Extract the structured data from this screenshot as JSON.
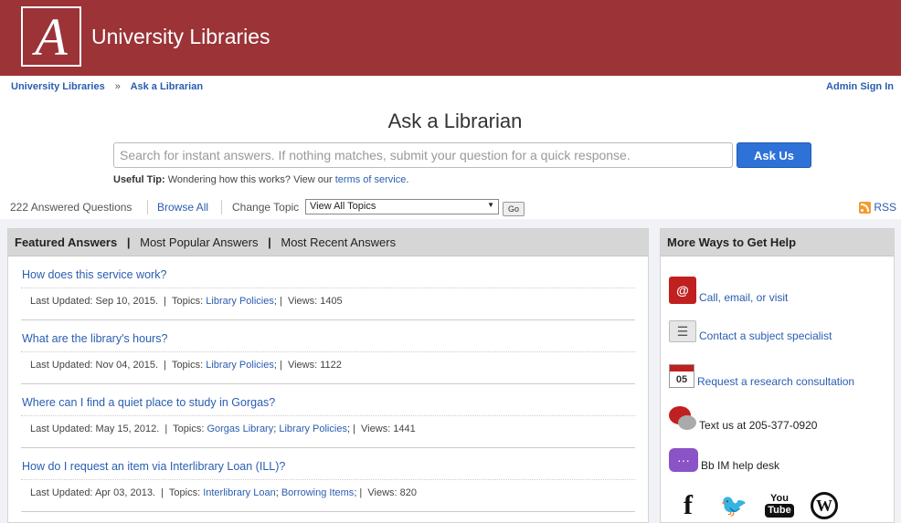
{
  "header": {
    "logo_letter": "A",
    "site_title": "University Libraries",
    "brand_color": "#9b3337"
  },
  "breadcrumb": {
    "items": [
      "University Libraries",
      "Ask a Librarian"
    ],
    "separator": "»",
    "admin_link": "Admin Sign In"
  },
  "page": {
    "title": "Ask a Librarian"
  },
  "search": {
    "placeholder": "Search for instant answers. If nothing matches, submit your question for a quick response.",
    "button_label": "Ask Us"
  },
  "tip": {
    "label": "Useful Tip:",
    "text": "Wondering how this works? View our",
    "link": "terms of service",
    "end": "."
  },
  "toolbar": {
    "answered_count": "222 Answered Questions",
    "browse_all": "Browse All",
    "change_topic": "Change Topic",
    "topic_selected": "View All Topics",
    "go_label": "Go",
    "rss_label": "RSS"
  },
  "tabs": {
    "featured": "Featured Answers",
    "popular": "Most Popular Answers",
    "recent": "Most Recent Answers",
    "sep": "|"
  },
  "questions": [
    {
      "title": "How does this service work?",
      "updated": "Last Updated: Sep 10, 2015.",
      "topics_label": "Topics:",
      "topics": [
        "Library Policies"
      ],
      "views": "Views: 1405"
    },
    {
      "title": "What are the library's hours?",
      "updated": "Last Updated: Nov 04, 2015.",
      "topics_label": "Topics:",
      "topics": [
        "Library Policies"
      ],
      "views": "Views: 1122"
    },
    {
      "title": "Where can I find a quiet place to study in Gorgas?",
      "updated": "Last Updated: May 15, 2012.",
      "topics_label": "Topics:",
      "topics": [
        "Gorgas Library",
        "Library Policies"
      ],
      "views": "Views: 1441"
    },
    {
      "title": "How do I request an item via Interlibrary Loan (ILL)?",
      "updated": "Last Updated: Apr 03, 2013.",
      "topics_label": "Topics:",
      "topics": [
        "Interlibrary Loan",
        "Borrowing Items"
      ],
      "views": "Views: 820"
    }
  ],
  "sidebar": {
    "title": "More Ways to Get Help",
    "items": [
      {
        "label": "Call, email, or visit",
        "icon": "contact-book-icon",
        "glyph": "@"
      },
      {
        "label": "Contact a subject specialist",
        "icon": "id-card-icon",
        "glyph": "☰"
      },
      {
        "label": "Request a research consultation",
        "icon": "calendar-icon",
        "glyph": "05"
      },
      {
        "label": "Text us at 205-377-0920",
        "icon": "chat-bubbles-icon"
      },
      {
        "label": "Bb IM help desk",
        "icon": "im-chat-icon",
        "glyph": "···"
      }
    ],
    "social": {
      "facebook": "f",
      "twitter": "🐦",
      "youtube_you": "You",
      "youtube_tube": "Tube",
      "wordpress": "W"
    }
  }
}
